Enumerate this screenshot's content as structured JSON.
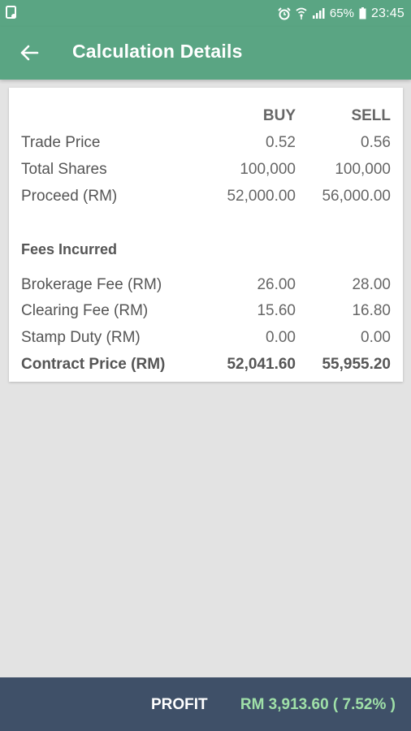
{
  "status_bar": {
    "battery_percent": "65%",
    "time": "23:45",
    "icons": [
      "notification-icon",
      "alarm-icon",
      "wifi-icon",
      "signal-icon",
      "battery-icon"
    ]
  },
  "app_bar": {
    "title": "Calculation Details",
    "back_icon": "arrow-left-icon"
  },
  "table": {
    "headers": {
      "buy": "BUY",
      "sell": "SELL"
    },
    "rows": [
      {
        "label": "Trade Price",
        "buy": "0.52",
        "sell": "0.56"
      },
      {
        "label": "Total Shares",
        "buy": "100,000",
        "sell": "100,000"
      },
      {
        "label": "Proceed (RM)",
        "buy": "52,000.00",
        "sell": "56,000.00"
      }
    ],
    "fees_title": "Fees Incurred",
    "fees": [
      {
        "label": "Brokerage Fee (RM)",
        "buy": "26.00",
        "sell": "28.00"
      },
      {
        "label": "Clearing Fee (RM)",
        "buy": "15.60",
        "sell": "16.80"
      },
      {
        "label": "Stamp Duty (RM)",
        "buy": "0.00",
        "sell": "0.00"
      }
    ],
    "total": {
      "label": "Contract Price (RM)",
      "buy": "52,041.60",
      "sell": "55,955.20"
    }
  },
  "bottom_bar": {
    "profit_label": "PROFIT",
    "profit_value": "RM 3,913.60 ( 7.52% )"
  },
  "colors": {
    "primary": "#5aa583",
    "bottom_bar": "#3f5068",
    "profit_value": "#9fe0a8"
  }
}
